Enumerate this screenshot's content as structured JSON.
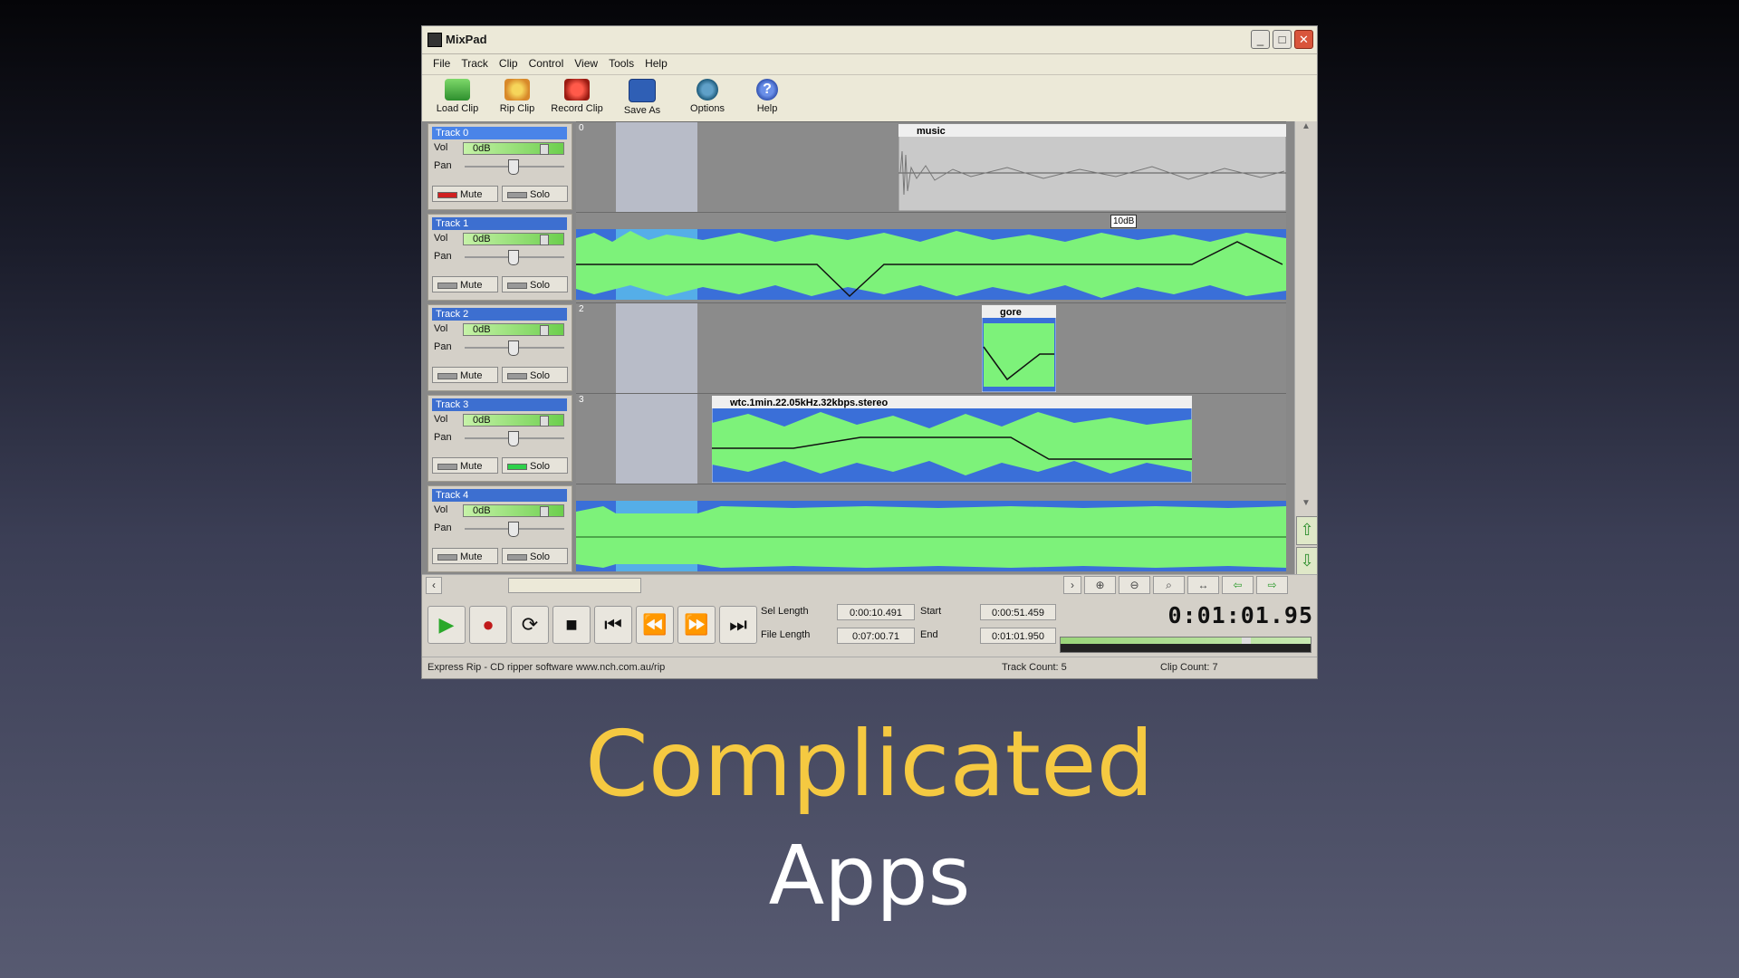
{
  "window": {
    "title": "MixPad",
    "btn_min": "_",
    "btn_max": "□",
    "btn_close": "✕"
  },
  "menu": [
    "File",
    "Track",
    "Clip",
    "Control",
    "View",
    "Tools",
    "Help"
  ],
  "toolbar": {
    "load_clip": "Load Clip",
    "rip_clip": "Rip Clip",
    "record_clip": "Record Clip",
    "save_as": "Save As",
    "options": "Options",
    "help": "Help"
  },
  "tracks": [
    {
      "name": "Track 0",
      "vol": "0dB",
      "num": "0",
      "mute_on": true,
      "solo_on": false
    },
    {
      "name": "Track 1",
      "vol": "0dB",
      "num": "1",
      "mute_on": false,
      "solo_on": false
    },
    {
      "name": "Track 2",
      "vol": "0dB",
      "num": "2",
      "mute_on": false,
      "solo_on": false
    },
    {
      "name": "Track 3",
      "vol": "0dB",
      "num": "3",
      "mute_on": false,
      "solo_on": true
    },
    {
      "name": "Track 4",
      "vol": "0dB",
      "num": "",
      "mute_on": false,
      "solo_on": false
    }
  ],
  "labels": {
    "vol": "Vol",
    "pan": "Pan",
    "mute": "Mute",
    "solo": "Solo"
  },
  "clips": {
    "music": "music",
    "gore": "gore",
    "wtc": "wtc.1min.22.05kHz.32kbps.stereo",
    "tooltip": "10dB"
  },
  "info": {
    "sel_length_label": "Sel Length",
    "sel_length": "0:00:10.491",
    "start_label": "Start",
    "start": "0:00:51.459",
    "file_length_label": "File Length",
    "file_length": "0:07:00.71",
    "end_label": "End",
    "end": "0:01:01.950",
    "clock": "0:01:01.95"
  },
  "status": {
    "left": "Express Rip - CD ripper software www.nch.com.au/rip",
    "track_count": "Track Count: 5",
    "clip_count": "Clip Count: 7"
  },
  "caption": {
    "line1": "Complicated",
    "line2": "Apps"
  },
  "colors": {
    "wave_fg": "#7df27a",
    "wave_bg": "#3a6fd8",
    "caption_accent": "#f5c941"
  }
}
